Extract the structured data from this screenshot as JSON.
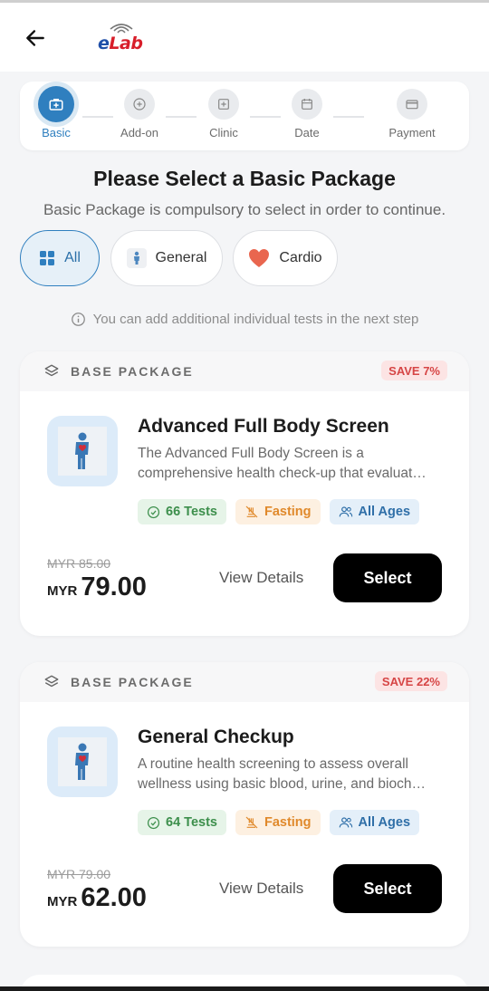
{
  "header": {
    "logo_e": "e",
    "logo_lab": "Lab"
  },
  "stepper": {
    "steps": [
      {
        "label": "Basic",
        "icon": "medical-kit-icon"
      },
      {
        "label": "Add-on",
        "icon": "plus-circle-icon"
      },
      {
        "label": "Clinic",
        "icon": "clinic-icon"
      },
      {
        "label": "Date",
        "icon": "calendar-icon"
      },
      {
        "label": "Payment",
        "icon": "card-icon"
      }
    ],
    "active_index": 0
  },
  "page": {
    "title": "Please Select a Basic Package",
    "subtitle": "Basic Package is compulsory to select in order to continue."
  },
  "filters": [
    {
      "label": "All",
      "icon": "grid-icon",
      "active": true
    },
    {
      "label": "General",
      "icon": "person-icon",
      "active": false
    },
    {
      "label": "Cardio",
      "icon": "heart-icon",
      "active": false
    }
  ],
  "info_text": "You can add additional individual tests in the next step",
  "packages": [
    {
      "tag": "BASE PACKAGE",
      "save": "SAVE 7%",
      "name": "Advanced Full Body Screen",
      "desc_line1": "The Advanced Full Body Screen is a",
      "desc_line2": "comprehensive health check-up that evaluat…",
      "tests": "66 Tests",
      "fasting": "Fasting",
      "ages": "All Ages",
      "old_price": "MYR 85.00",
      "currency": "MYR",
      "price": "79.00",
      "view_label": "View Details",
      "select_label": "Select"
    },
    {
      "tag": "BASE PACKAGE",
      "save": "SAVE 22%",
      "name": "General Checkup",
      "desc_line1": "A routine health screening to assess overall",
      "desc_line2": "wellness using basic blood, urine, and bioch…",
      "tests": "64 Tests",
      "fasting": "Fasting",
      "ages": "All Ages",
      "old_price": "MYR 79.00",
      "currency": "MYR",
      "price": "62.00",
      "view_label": "View Details",
      "select_label": "Select"
    }
  ],
  "colors": {
    "accent": "#2f7fbf",
    "save": "#d64545",
    "tests": "#3d8f4c",
    "fasting": "#e0892b",
    "ages": "#2f6fa8"
  }
}
